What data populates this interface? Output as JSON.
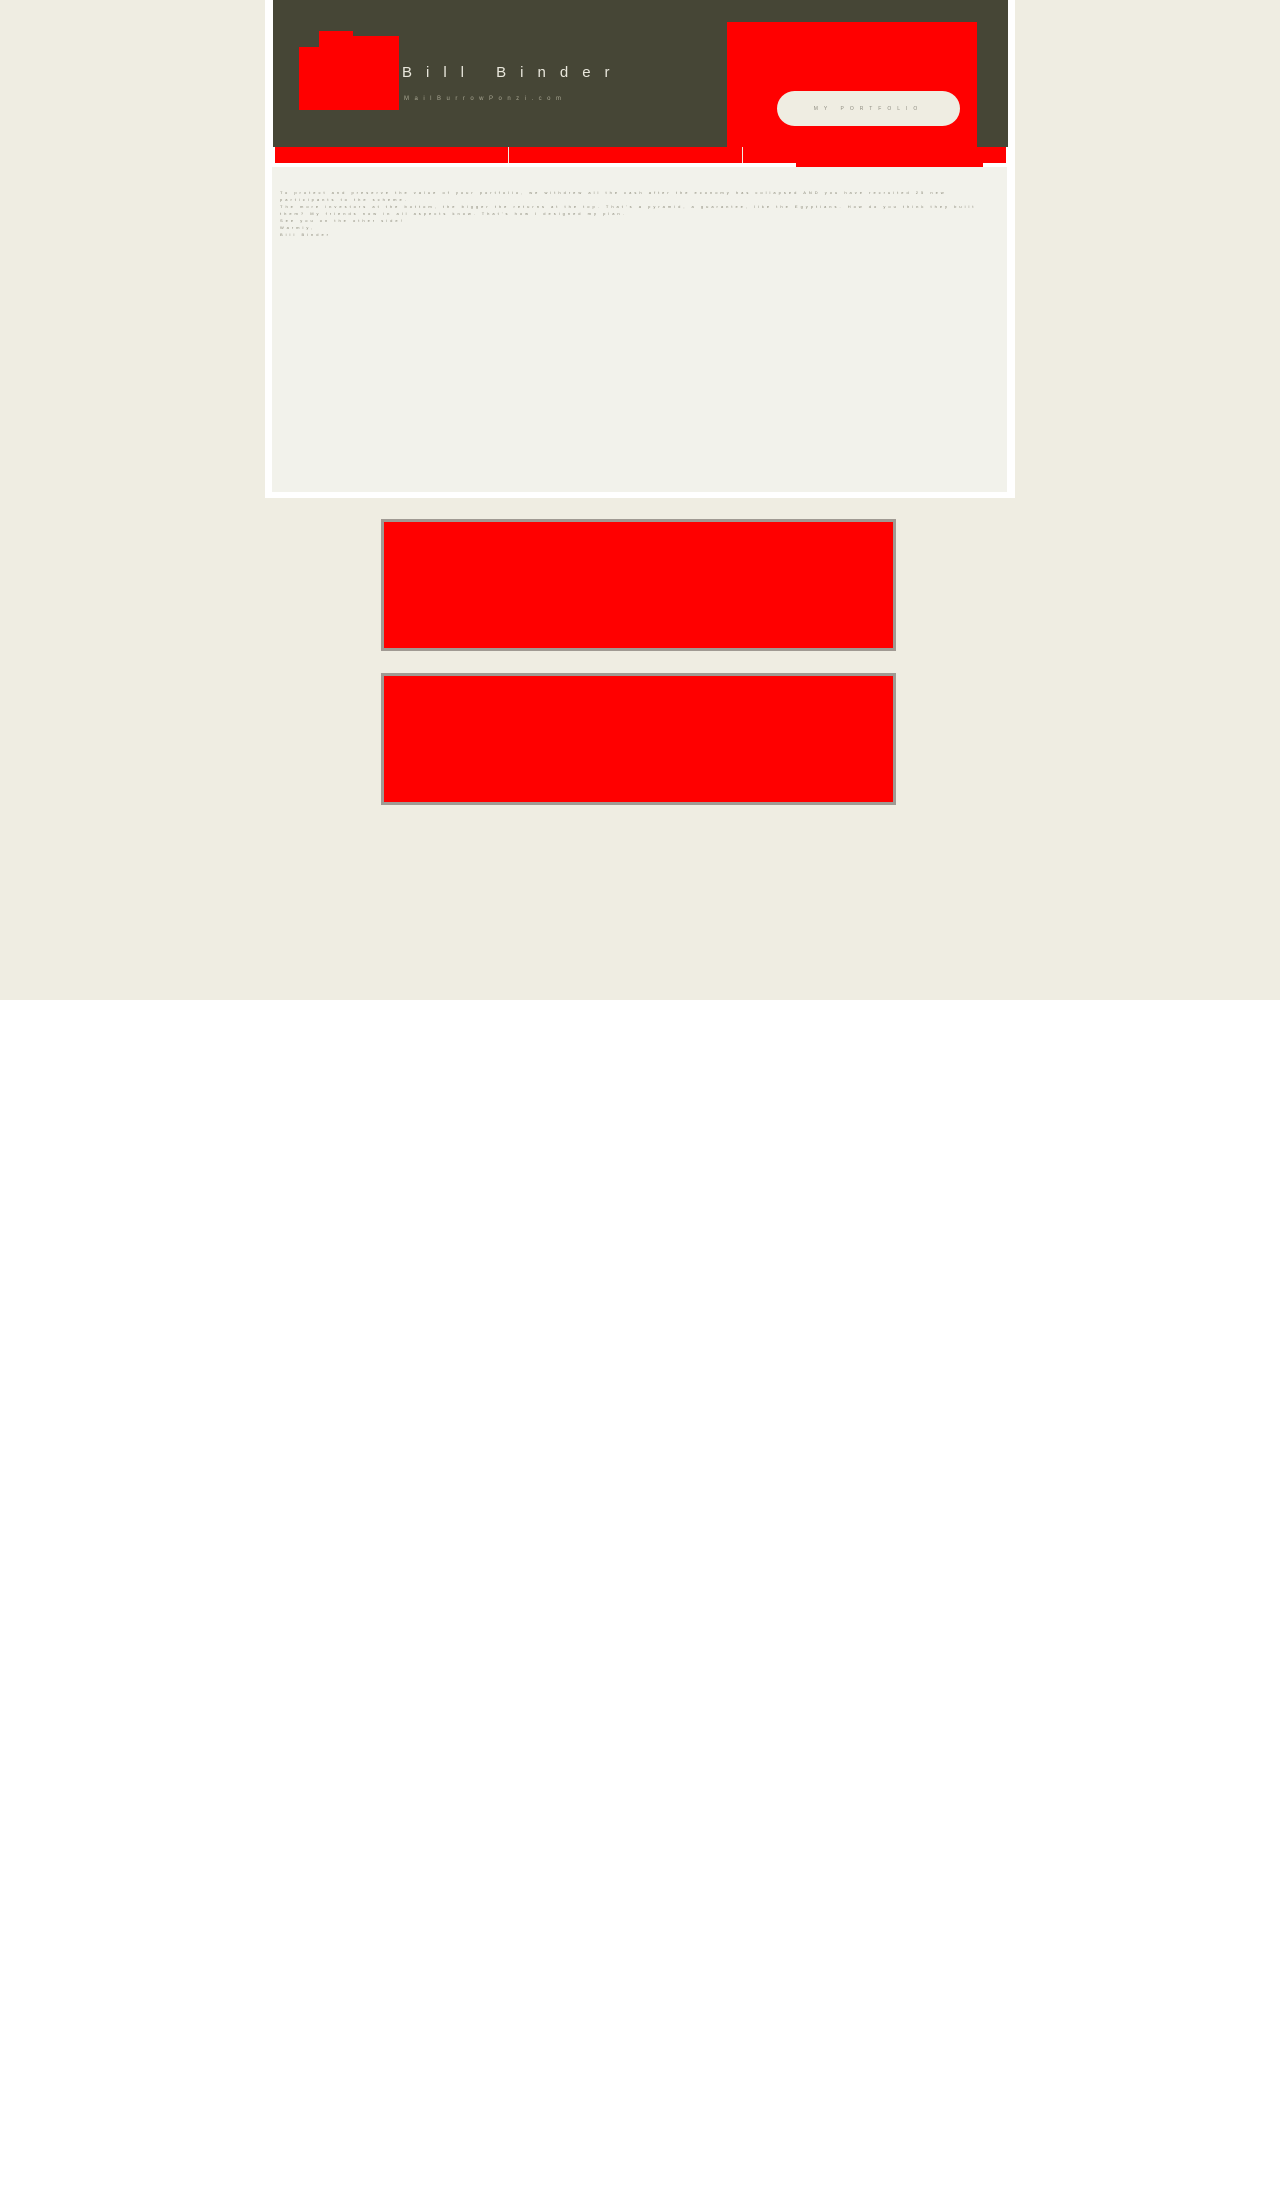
{
  "site": {
    "name": "Bill Binder",
    "url": "MailBurrowPonzi.com"
  },
  "header": {
    "portfolio_button": "MY PORTFOLIO"
  },
  "nav": {
    "tabs": [
      {
        "label": ""
      },
      {
        "label": ""
      },
      {
        "label": ""
      }
    ]
  },
  "content": {
    "lines": [
      "To protect and preserve the value of your portfolio, we withdrew all the cash after the economy has collapsed AND you have recruited 25 new participants to the scheme.",
      "The more investors at the bottom, the bigger the returns at the top. That's a pyramid, a guarantee, like the Egyptians. How do you think they built them? My friends now in all aspects know. That's how I designed my plan.",
      "See you on the other side!",
      "Warmly,",
      "Bill Binder"
    ]
  },
  "colors": {
    "page_background": "#efede2",
    "header_background": "#464636",
    "accent": "#ff0000",
    "content_background": "#f2f2eb",
    "banner_border": "#a09a93"
  }
}
